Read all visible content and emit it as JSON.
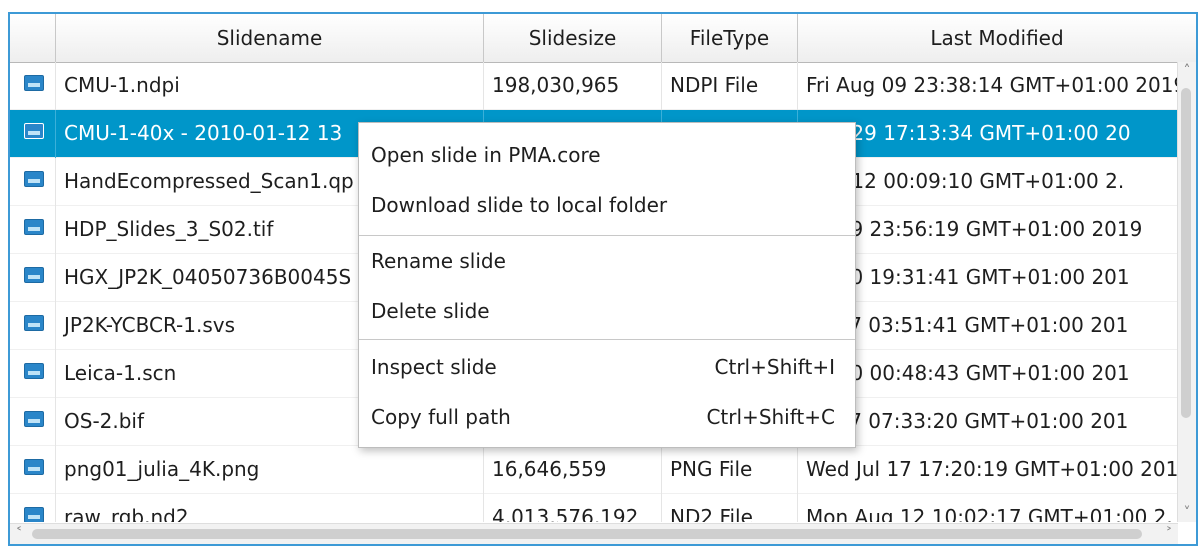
{
  "table": {
    "columns": [
      "Slidename",
      "Slidesize",
      "FileType",
      "Last Modified"
    ],
    "rows": [
      {
        "name": "CMU-1.ndpi",
        "size": "198,030,965",
        "type": "NDPI File",
        "modified": "Fri Aug 09 23:38:14 GMT+01:00 2019"
      },
      {
        "name": "CMU-1-40x - 2010-01-12 13",
        "size": "",
        "type": "",
        "modified": "Aug 29 17:13:34 GMT+01:00 20"
      },
      {
        "name": "HandEcompressed_Scan1.qp",
        "size": "",
        "type": "",
        "modified": "Aug 12 00:09:10 GMT+01:00 2."
      },
      {
        "name": "HDP_Slides_3_S02.tif",
        "size": "",
        "type": "",
        "modified": "ug 09 23:56:19 GMT+01:00 2019"
      },
      {
        "name": "HGX_JP2K_04050736B0045S",
        "size": "",
        "type": "",
        "modified": "ug 10 19:31:41 GMT+01:00 201"
      },
      {
        "name": "JP2K-YCBCR-1.svs",
        "size": "",
        "type": "",
        "modified": "Jul 17 03:51:41 GMT+01:00 201"
      },
      {
        "name": "Leica-1.scn",
        "size": "",
        "type": "",
        "modified": "ug 10 00:48:43 GMT+01:00 201"
      },
      {
        "name": "OS-2.bif",
        "size": "",
        "type": "",
        "modified": "Jul 17 07:33:20 GMT+01:00 201"
      },
      {
        "name": "png01_julia_4K.png",
        "size": "16,646,559",
        "type": "PNG File",
        "modified": "Wed Jul 17 17:20:19 GMT+01:00 201"
      },
      {
        "name": "raw_rgb.nd2",
        "size": "4,013,576,192",
        "type": "ND2 File",
        "modified": "Mon Aug 12 10:02:17 GMT+01:00 2."
      }
    ]
  },
  "context_menu": {
    "items": [
      {
        "label": "Open slide in PMA.core",
        "shortcut": ""
      },
      {
        "label": "Download slide to local folder",
        "shortcut": ""
      },
      {
        "label": "Rename slide",
        "shortcut": ""
      },
      {
        "label": "Delete slide",
        "shortcut": ""
      },
      {
        "label": "Inspect slide",
        "shortcut": "Ctrl+Shift+I"
      },
      {
        "label": "Copy full path",
        "shortcut": "Ctrl+Shift+C"
      }
    ]
  },
  "icons": {
    "row_icon": "slide-image-icon",
    "scroll_up": "chevron-up-icon",
    "scroll_down": "chevron-down-icon",
    "scroll_left": "chevron-left-icon",
    "scroll_right": "chevron-right-icon"
  },
  "colors": {
    "selection": "#0096c9",
    "frame_border": "#3d9ad6",
    "icon": "#2a86c9"
  }
}
